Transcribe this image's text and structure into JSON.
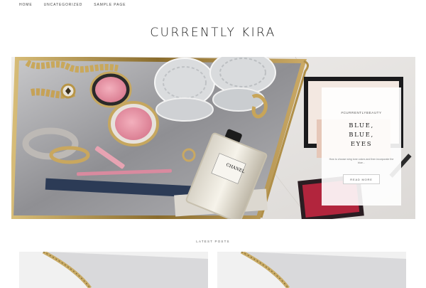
{
  "nav": {
    "items": [
      "Home",
      "Uncategorized",
      "Sample Page"
    ]
  },
  "site": {
    "title": "CURRENTLY KIRA"
  },
  "hero": {
    "tag": "#CURRENTLYBEAUTY",
    "title": "BLUE,\nBLUE,\nEYES",
    "excerpt": "How to choose wing tone colors and then incorporate the blue...",
    "button": "READ MORE",
    "brand_bottle": "CHANEL"
  },
  "latest": {
    "heading": "LATEST POSTS"
  },
  "colors": {
    "accent_gold": "#b89a55",
    "pink": "#e39aa9",
    "navy": "#2e3e5a"
  }
}
